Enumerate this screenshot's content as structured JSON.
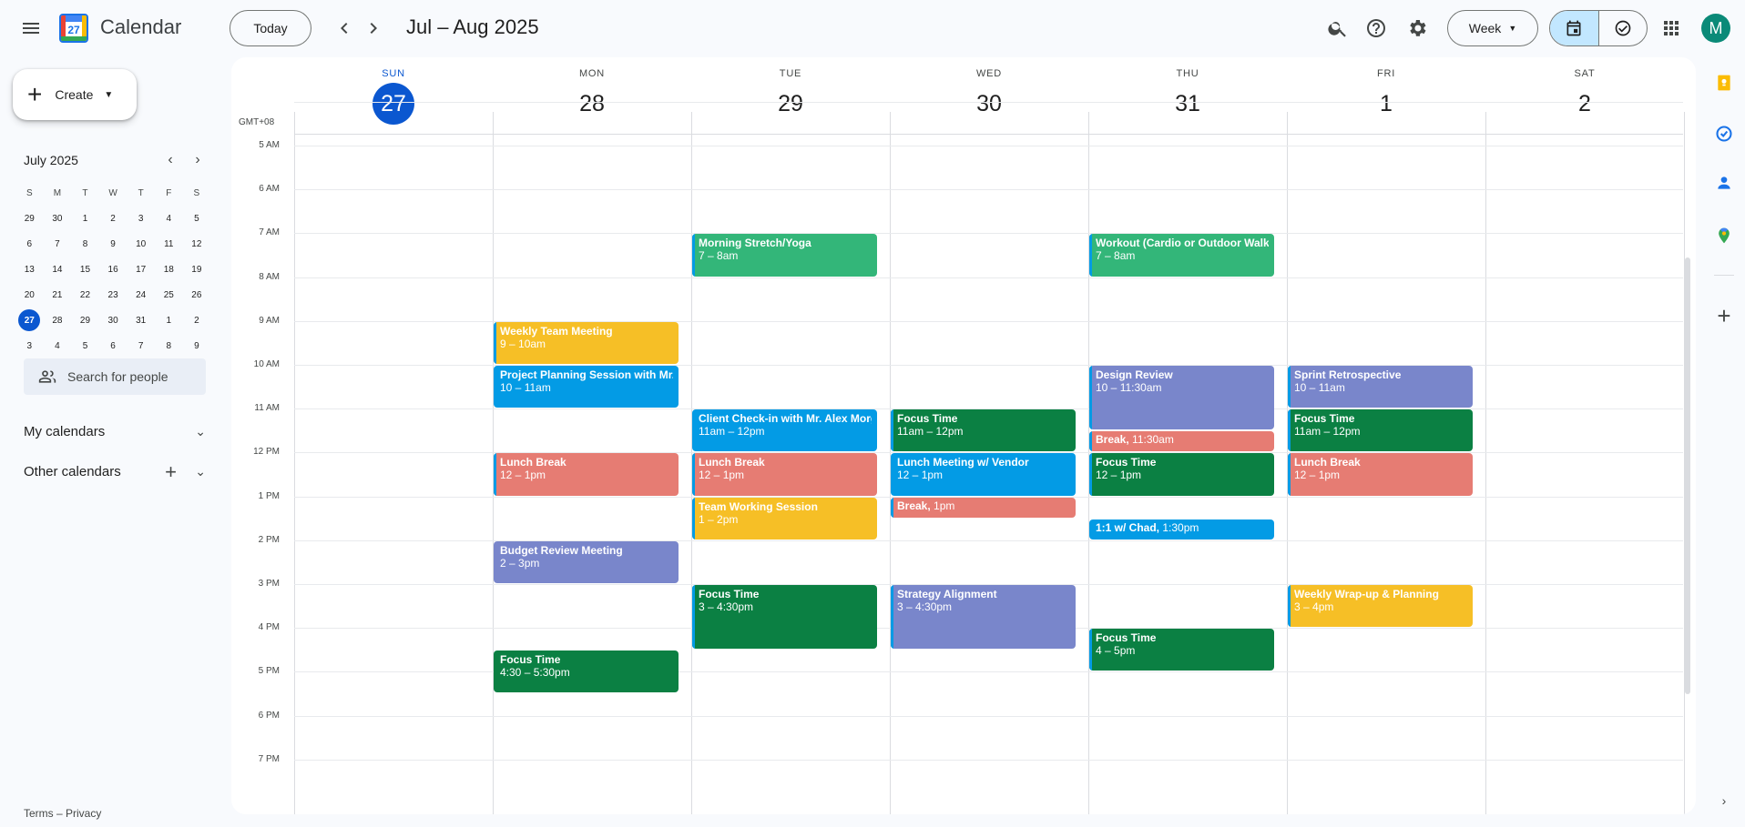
{
  "header": {
    "app_title": "Calendar",
    "logo_day": "27",
    "today_label": "Today",
    "date_range": "Jul – Aug 2025",
    "view_label": "Week",
    "avatar_initial": "M"
  },
  "sidebar": {
    "create_label": "Create",
    "mini_month": "July 2025",
    "mini_dow": [
      "S",
      "M",
      "T",
      "W",
      "T",
      "F",
      "S"
    ],
    "mini_weeks": [
      [
        "29",
        "30",
        "1",
        "2",
        "3",
        "4",
        "5"
      ],
      [
        "6",
        "7",
        "8",
        "9",
        "10",
        "11",
        "12"
      ],
      [
        "13",
        "14",
        "15",
        "16",
        "17",
        "18",
        "19"
      ],
      [
        "20",
        "21",
        "22",
        "23",
        "24",
        "25",
        "26"
      ],
      [
        "27",
        "28",
        "29",
        "30",
        "31",
        "1",
        "2"
      ],
      [
        "3",
        "4",
        "5",
        "6",
        "7",
        "8",
        "9"
      ]
    ],
    "selected_date": "27",
    "search_people_placeholder": "Search for people",
    "my_calendars": "My calendars",
    "other_calendars": "Other calendars",
    "footer": "Terms – Privacy"
  },
  "grid": {
    "timezone": "GMT+08",
    "days": [
      {
        "dow": "SUN",
        "num": "27",
        "today": true
      },
      {
        "dow": "MON",
        "num": "28"
      },
      {
        "dow": "TUE",
        "num": "29"
      },
      {
        "dow": "WED",
        "num": "30"
      },
      {
        "dow": "THU",
        "num": "31"
      },
      {
        "dow": "FRI",
        "num": "1"
      },
      {
        "dow": "SAT",
        "num": "2"
      }
    ],
    "hours": [
      "5 AM",
      "6 AM",
      "7 AM",
      "8 AM",
      "9 AM",
      "10 AM",
      "11 AM",
      "12 PM",
      "1 PM",
      "2 PM",
      "3 PM",
      "4 PM",
      "5 PM",
      "6 PM",
      "7 PM"
    ]
  },
  "colors": {
    "green_light": "#33b679",
    "green_dark": "#0b8043",
    "yellow": "#f6bf26",
    "blue": "#039be5",
    "lavender": "#7986cb",
    "salmon": "#e67c73",
    "today_blue": "#0b57d0"
  },
  "events": [
    {
      "day": 1,
      "start": 9,
      "end": 10,
      "title": "Weekly Team Meeting",
      "time": "9 – 10am",
      "color": "#f6bf26",
      "stripe": true
    },
    {
      "day": 1,
      "start": 10,
      "end": 11,
      "title": "Project Planning Session with Mr. J",
      "time": "10 – 11am",
      "color": "#039be5",
      "stripe": false
    },
    {
      "day": 1,
      "start": 12,
      "end": 13,
      "title": "Lunch Break",
      "time": "12 – 1pm",
      "color": "#e67c73",
      "stripe": true
    },
    {
      "day": 1,
      "start": 14,
      "end": 15,
      "title": "Budget Review Meeting",
      "time": "2 – 3pm",
      "color": "#7986cb",
      "stripe": false
    },
    {
      "day": 1,
      "start": 16.5,
      "end": 17.5,
      "title": "Focus Time",
      "time": "4:30 – 5:30pm",
      "color": "#0b8043",
      "stripe": false
    },
    {
      "day": 2,
      "start": 7,
      "end": 8,
      "title": "Morning Stretch/Yoga",
      "time": "7 – 8am",
      "color": "#33b679",
      "stripe": true
    },
    {
      "day": 2,
      "start": 11,
      "end": 12,
      "title": "Client Check-in with Mr. Alex Morg",
      "time": "11am – 12pm",
      "color": "#039be5",
      "stripe": false
    },
    {
      "day": 2,
      "start": 12,
      "end": 13,
      "title": "Lunch Break",
      "time": "12 – 1pm",
      "color": "#e67c73",
      "stripe": true
    },
    {
      "day": 2,
      "start": 13,
      "end": 14,
      "title": "Team Working Session",
      "time": "1 – 2pm",
      "color": "#f6bf26",
      "stripe": true
    },
    {
      "day": 2,
      "start": 15,
      "end": 16.5,
      "title": "Focus Time",
      "time": "3 – 4:30pm",
      "color": "#0b8043",
      "stripe": true
    },
    {
      "day": 3,
      "start": 11,
      "end": 12,
      "title": "Focus Time",
      "time": "11am – 12pm",
      "color": "#0b8043",
      "stripe": true
    },
    {
      "day": 3,
      "start": 12,
      "end": 13,
      "title": "Lunch Meeting w/ Vendor",
      "time": "12 – 1pm",
      "color": "#039be5",
      "stripe": false
    },
    {
      "day": 3,
      "start": 13,
      "end": 13.5,
      "title": "Break,",
      "time": "1pm",
      "color": "#e67c73",
      "stripe": true,
      "short": true
    },
    {
      "day": 3,
      "start": 15,
      "end": 16.5,
      "title": "Strategy Alignment",
      "time": "3 – 4:30pm",
      "color": "#7986cb",
      "stripe": true
    },
    {
      "day": 4,
      "start": 7,
      "end": 8,
      "title": "Workout (Cardio or Outdoor Walk)",
      "time": "7 – 8am",
      "color": "#33b679",
      "stripe": true
    },
    {
      "day": 4,
      "start": 10,
      "end": 11.5,
      "title": "Design Review",
      "time": "10 – 11:30am",
      "color": "#7986cb",
      "stripe": true
    },
    {
      "day": 4,
      "start": 11.5,
      "end": 12,
      "title": "Break,",
      "time": "11:30am",
      "color": "#e67c73",
      "stripe": true,
      "short": true
    },
    {
      "day": 4,
      "start": 12,
      "end": 13,
      "title": "Focus Time",
      "time": "12 – 1pm",
      "color": "#0b8043",
      "stripe": true
    },
    {
      "day": 4,
      "start": 13.5,
      "end": 14,
      "title": "1:1 w/ Chad,",
      "time": "1:30pm",
      "color": "#039be5",
      "stripe": false,
      "short": true
    },
    {
      "day": 4,
      "start": 16,
      "end": 17,
      "title": "Focus Time",
      "time": "4 – 5pm",
      "color": "#0b8043",
      "stripe": true
    },
    {
      "day": 5,
      "start": 10,
      "end": 11,
      "title": "Sprint Retrospective",
      "time": "10 – 11am",
      "color": "#7986cb",
      "stripe": true
    },
    {
      "day": 5,
      "start": 11,
      "end": 12,
      "title": "Focus Time",
      "time": "11am – 12pm",
      "color": "#0b8043",
      "stripe": true
    },
    {
      "day": 5,
      "start": 12,
      "end": 13,
      "title": "Lunch Break",
      "time": "12 – 1pm",
      "color": "#e67c73",
      "stripe": true
    },
    {
      "day": 5,
      "start": 15,
      "end": 16,
      "title": "Weekly Wrap-up & Planning",
      "time": "3 – 4pm",
      "color": "#f6bf26",
      "stripe": true
    }
  ]
}
